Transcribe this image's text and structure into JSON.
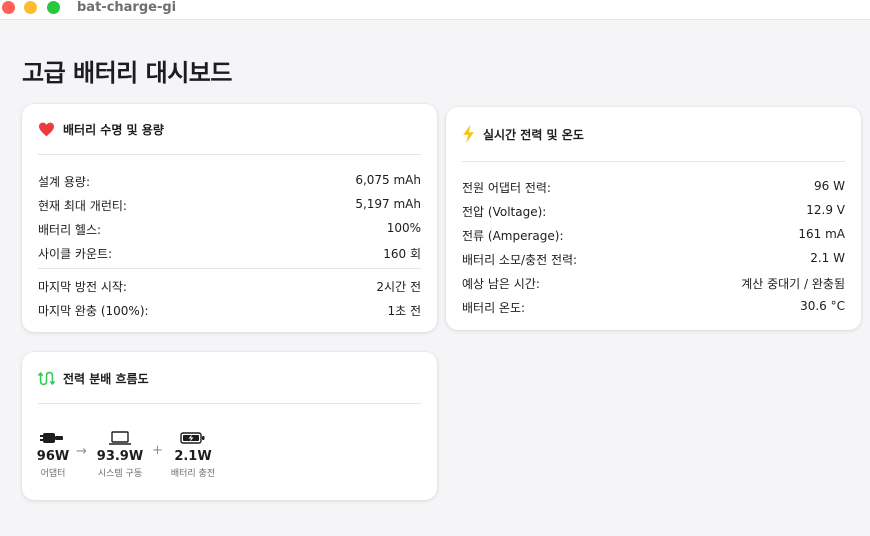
{
  "window": {
    "title": "bat-charge-gi"
  },
  "page": {
    "title": "고급 배터리 대시보드"
  },
  "battery_card": {
    "title": "배터리 수명 및 용량",
    "icon": "heart-icon",
    "icon_color": "#ef3b3b",
    "rows": [
      {
        "label": "설계 용량:",
        "value": "6,075 mAh"
      },
      {
        "label": "현재 최대 개런티:",
        "value": "5,197 mAh"
      },
      {
        "label": "배터리 헬스:",
        "value": "100%"
      },
      {
        "label": "사이클 카운트:",
        "value": "160 회"
      },
      {
        "label": "마지막 방전 시작:",
        "value": "2시간 전"
      },
      {
        "label": "마지막 완충 (100%):",
        "value": "1초 전"
      }
    ]
  },
  "power_card": {
    "title": "실시간 전력 및 온도",
    "icon": "lightning-icon",
    "icon_color": "#f5c518",
    "rows": [
      {
        "label": "전원 어댑터 전력:",
        "value": "96 W"
      },
      {
        "label": "전압 (Voltage):",
        "value": "12.9 V"
      },
      {
        "label": "전류 (Amperage):",
        "value": "161 mA"
      },
      {
        "label": "배터리 소모/충전 전력:",
        "value": "2.1 W"
      },
      {
        "label": "예상 남은 시간:",
        "value": "계산 중대기 / 완충됨"
      },
      {
        "label": "배터리 온도:",
        "value": "30.6 °C"
      }
    ]
  },
  "flow_card": {
    "title": "전력 분배 흐름도",
    "icon": "flow-arrows-icon",
    "icon_color": "#34c759",
    "items": [
      {
        "icon": "plug-icon",
        "value": "96W",
        "label": "어댑터"
      },
      {
        "icon": "laptop-icon",
        "value": "93.9W",
        "label": "시스템 구동"
      },
      {
        "icon": "battery-charging-icon",
        "value": "2.1W",
        "label": "배터리 충전"
      }
    ],
    "operators": [
      "→",
      "+"
    ]
  }
}
